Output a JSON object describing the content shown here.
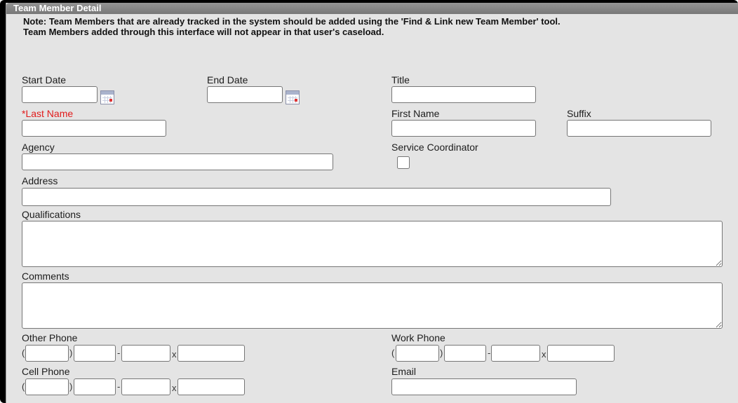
{
  "header": {
    "title": "Team Member Detail"
  },
  "note": {
    "line1": "Note: Team Members that are already tracked in the system should be added using the 'Find & Link new Team Member' tool.",
    "line2": "Team Members added through this interface will not appear in that user's caseload."
  },
  "labels": {
    "start_date": "Start Date",
    "end_date": "End Date",
    "title": "Title",
    "last_name_marker": "*",
    "last_name": "Last Name",
    "first_name": "First Name",
    "suffix": "Suffix",
    "agency": "Agency",
    "service_coordinator": "Service Coordinator",
    "address": "Address",
    "qualifications": "Qualifications",
    "comments": "Comments",
    "other_phone": "Other Phone",
    "work_phone": "Work Phone",
    "cell_phone": "Cell Phone",
    "email": "Email"
  },
  "phone_separators": {
    "open": "(",
    "close": ")",
    "dash": "-",
    "ext": "x"
  },
  "values": {
    "start_date": "",
    "end_date": "",
    "title": "",
    "last_name": "",
    "first_name": "",
    "suffix": "",
    "agency": "",
    "address": "",
    "qualifications": "",
    "comments": "",
    "email": ""
  },
  "colors": {
    "header": "#808080",
    "panel": "#e4e4e4",
    "required": "#e11b1b"
  },
  "icons": {
    "date_picker": "calendar-icon"
  }
}
